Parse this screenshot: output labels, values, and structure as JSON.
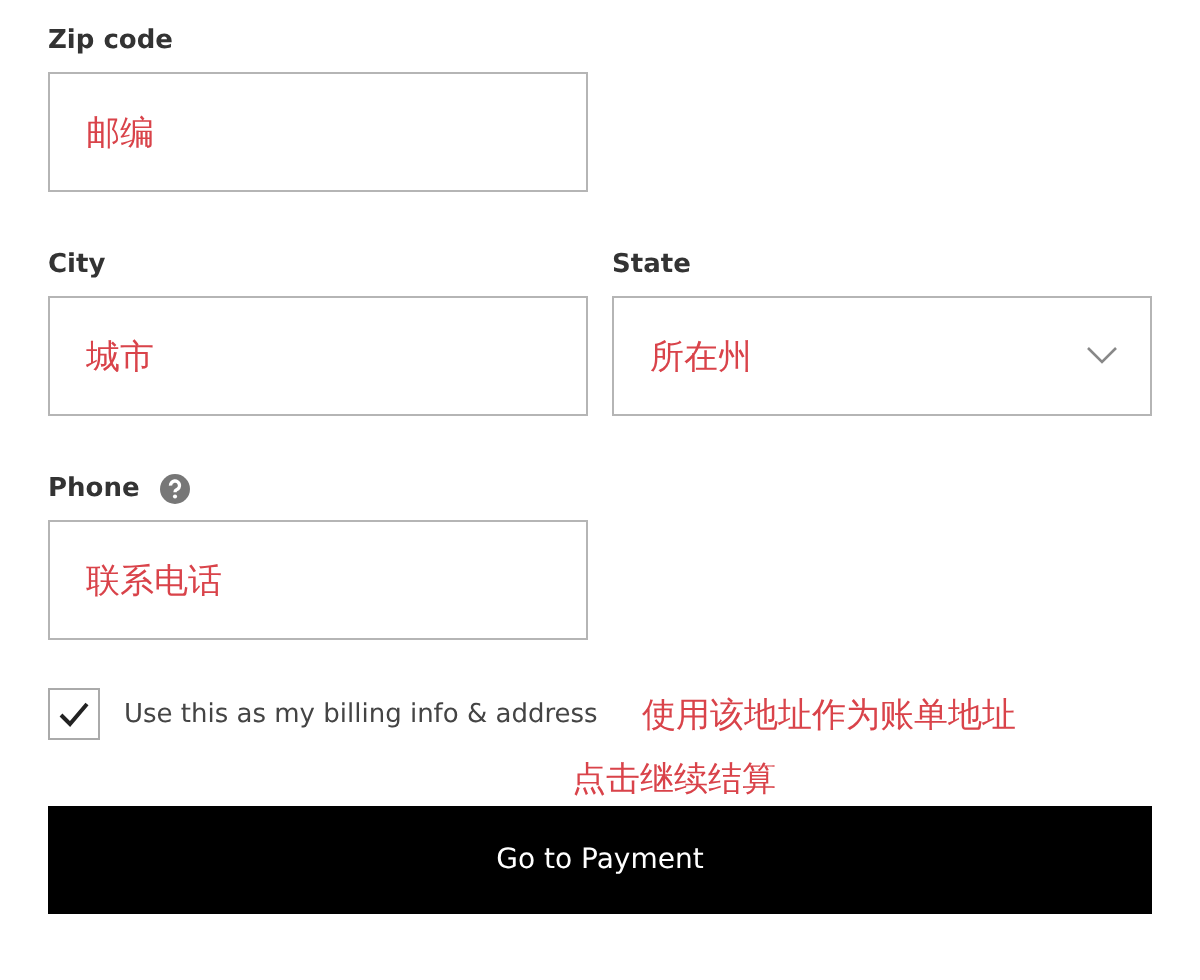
{
  "form_rows": [
    {
      "fields": [
        {
          "label": "Zip code",
          "kind": "text",
          "help": false,
          "note": "邮编"
        }
      ]
    },
    {
      "fields": [
        {
          "label": "City",
          "kind": "text",
          "help": false,
          "note": "城市"
        },
        {
          "label": "State",
          "kind": "select",
          "help": false,
          "note": "所在州"
        }
      ]
    },
    {
      "fields": [
        {
          "label": "Phone",
          "kind": "text",
          "help": true,
          "note": "联系电话"
        }
      ]
    }
  ],
  "billing_checkbox": {
    "label": "Use this as my billing info & address",
    "checked": true,
    "note": "使用该地址作为账单地址"
  },
  "button_note": "点击继续结算",
  "submit_button": {
    "label": "Go to Payment"
  }
}
